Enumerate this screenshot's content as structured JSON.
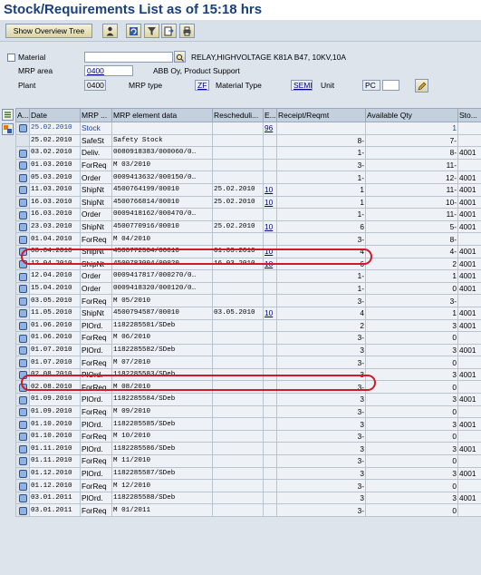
{
  "title": "Stock/Requirements List as of 15:18 hrs",
  "toolbar": {
    "overview_tree_label": "Show Overview Tree"
  },
  "header": {
    "material_label": "Material",
    "material_value": "",
    "material_desc": "RELAY,HIGHVOLTAGE K81A B47, 10KV,10A",
    "mrp_area_label": "MRP area",
    "mrp_area_value": "0400",
    "mrp_area_desc": "ABB Oy, Product Support",
    "plant_label": "Plant",
    "plant_value": "0400",
    "mrp_type_label": "MRP type",
    "mrp_type_value": "ZF",
    "material_type_label": "Material Type",
    "material_type_value": "SEMI",
    "unit_label": "Unit",
    "unit_value": "PC"
  },
  "table": {
    "columns": [
      "A...",
      "Date",
      "MRP ...",
      "MRP element data",
      "Rescheduli...",
      "E...",
      "Receipt/Reqmt",
      "Available Qty",
      "Sto..."
    ],
    "rows": [
      {
        "date": "25.02.2010",
        "elem": "Stock",
        "data": "",
        "resched": "",
        "e": "96",
        "rec": "",
        "avail": "1",
        "sto": "",
        "icon": true,
        "blue": true
      },
      {
        "date": "25.02.2010",
        "elem": "SafeSt",
        "data": "Safety Stock",
        "resched": "",
        "e": "",
        "rec": "8-",
        "avail": "7-",
        "sto": "",
        "icon": false,
        "blue": false
      },
      {
        "date": "03.02.2010",
        "elem": "Deliv.",
        "data": "0080918383/000060/0…",
        "resched": "",
        "e": "",
        "rec": "1-",
        "avail": "8-",
        "sto": "4001",
        "icon": true,
        "blue": false
      },
      {
        "date": "01.03.2010",
        "elem": "ForReq",
        "data": "M 03/2010",
        "resched": "",
        "e": "",
        "rec": "3-",
        "avail": "11-",
        "sto": "",
        "icon": true,
        "blue": false
      },
      {
        "date": "05.03.2010",
        "elem": "Order",
        "data": "0009413632/000150/0…",
        "resched": "",
        "e": "",
        "rec": "1-",
        "avail": "12-",
        "sto": "4001",
        "icon": true,
        "blue": false
      },
      {
        "date": "11.03.2010",
        "elem": "ShipNt",
        "data": "4500764199/00010",
        "resched": "25.02.2010",
        "e": "10",
        "rec": "1",
        "avail": "11-",
        "sto": "4001",
        "icon": true,
        "blue": false
      },
      {
        "date": "16.03.2010",
        "elem": "ShipNt",
        "data": "4500766814/00010",
        "resched": "25.02.2010",
        "e": "10",
        "rec": "1",
        "avail": "10-",
        "sto": "4001",
        "icon": true,
        "blue": false
      },
      {
        "date": "16.03.2010",
        "elem": "Order",
        "data": "0009418162/000470/0…",
        "resched": "",
        "e": "",
        "rec": "1-",
        "avail": "11-",
        "sto": "4001",
        "icon": true,
        "blue": false
      },
      {
        "date": "23.03.2010",
        "elem": "ShipNt",
        "data": "4500770916/00010",
        "resched": "25.02.2010",
        "e": "10",
        "rec": "6",
        "avail": "5-",
        "sto": "4001",
        "icon": true,
        "blue": false
      },
      {
        "date": "01.04.2010",
        "elem": "ForReq",
        "data": "M 04/2010",
        "resched": "",
        "e": "",
        "rec": "3-",
        "avail": "8-",
        "sto": "",
        "icon": true,
        "blue": false
      },
      {
        "date": "08.04.2010",
        "elem": "ShipNt",
        "data": "4500772504/00010",
        "resched": "01.03.2010",
        "e": "10",
        "rec": "4",
        "avail": "4-",
        "sto": "4001",
        "icon": true,
        "blue": false
      },
      {
        "date": "12.04.2010",
        "elem": "ShipNt",
        "data": "4500783004/00020",
        "resched": "16.03.2010",
        "e": "10",
        "rec": "6",
        "avail": "2",
        "sto": "4001",
        "icon": true,
        "blue": false
      },
      {
        "date": "12.04.2010",
        "elem": "Order",
        "data": "0009417817/000270/0…",
        "resched": "",
        "e": "",
        "rec": "1-",
        "avail": "1",
        "sto": "4001",
        "icon": true,
        "blue": false
      },
      {
        "date": "15.04.2010",
        "elem": "Order",
        "data": "0009418320/000120/0…",
        "resched": "",
        "e": "",
        "rec": "1-",
        "avail": "0",
        "sto": "4001",
        "icon": true,
        "blue": false
      },
      {
        "date": "03.05.2010",
        "elem": "ForReq",
        "data": "M 05/2010",
        "resched": "",
        "e": "",
        "rec": "3-",
        "avail": "3-",
        "sto": "",
        "icon": true,
        "blue": false
      },
      {
        "date": "11.05.2010",
        "elem": "ShipNt",
        "data": "4500794587/00010",
        "resched": "03.05.2010",
        "e": "10",
        "rec": "4",
        "avail": "1",
        "sto": "4001",
        "icon": true,
        "blue": false
      },
      {
        "date": "01.06.2010",
        "elem": "PlOrd.",
        "data": "1182285581/SDeb",
        "resched": "",
        "e": "",
        "rec": "2",
        "avail": "3",
        "sto": "4001",
        "icon": true,
        "blue": false
      },
      {
        "date": "01.06.2010",
        "elem": "ForReq",
        "data": "M 06/2010",
        "resched": "",
        "e": "",
        "rec": "3-",
        "avail": "0",
        "sto": "",
        "icon": true,
        "blue": false
      },
      {
        "date": "01.07.2010",
        "elem": "PlOrd.",
        "data": "1182285582/SDeb",
        "resched": "",
        "e": "",
        "rec": "3",
        "avail": "3",
        "sto": "4001",
        "icon": true,
        "blue": false
      },
      {
        "date": "01.07.2010",
        "elem": "ForReq",
        "data": "M 07/2010",
        "resched": "",
        "e": "",
        "rec": "3-",
        "avail": "0",
        "sto": "",
        "icon": true,
        "blue": false
      },
      {
        "date": "02.08.2010",
        "elem": "PlOrd.",
        "data": "1182285583/SDeb",
        "resched": "",
        "e": "",
        "rec": "3",
        "avail": "3",
        "sto": "4001",
        "icon": true,
        "blue": false
      },
      {
        "date": "02.08.2010",
        "elem": "ForReq",
        "data": "M 08/2010",
        "resched": "",
        "e": "",
        "rec": "3-",
        "avail": "0",
        "sto": "",
        "icon": true,
        "blue": false
      },
      {
        "date": "01.09.2010",
        "elem": "PlOrd.",
        "data": "1182285584/SDeb",
        "resched": "",
        "e": "",
        "rec": "3",
        "avail": "3",
        "sto": "4001",
        "icon": true,
        "blue": false
      },
      {
        "date": "01.09.2010",
        "elem": "ForReq",
        "data": "M 09/2010",
        "resched": "",
        "e": "",
        "rec": "3-",
        "avail": "0",
        "sto": "",
        "icon": true,
        "blue": false
      },
      {
        "date": "01.10.2010",
        "elem": "PlOrd.",
        "data": "1182285585/SDeb",
        "resched": "",
        "e": "",
        "rec": "3",
        "avail": "3",
        "sto": "4001",
        "icon": true,
        "blue": false
      },
      {
        "date": "01.10.2010",
        "elem": "ForReq",
        "data": "M 10/2010",
        "resched": "",
        "e": "",
        "rec": "3-",
        "avail": "0",
        "sto": "",
        "icon": true,
        "blue": false
      },
      {
        "date": "01.11.2010",
        "elem": "PlOrd.",
        "data": "1182285586/SDeb",
        "resched": "",
        "e": "",
        "rec": "3",
        "avail": "3",
        "sto": "4001",
        "icon": true,
        "blue": false
      },
      {
        "date": "01.11.2010",
        "elem": "ForReq",
        "data": "M 11/2010",
        "resched": "",
        "e": "",
        "rec": "3-",
        "avail": "0",
        "sto": "",
        "icon": true,
        "blue": false
      },
      {
        "date": "01.12.2010",
        "elem": "PlOrd.",
        "data": "1182285587/SDeb",
        "resched": "",
        "e": "",
        "rec": "3",
        "avail": "3",
        "sto": "4001",
        "icon": true,
        "blue": false
      },
      {
        "date": "01.12.2010",
        "elem": "ForReq",
        "data": "M 12/2010",
        "resched": "",
        "e": "",
        "rec": "3-",
        "avail": "0",
        "sto": "",
        "icon": true,
        "blue": false
      },
      {
        "date": "03.01.2011",
        "elem": "PlOrd.",
        "data": "1182285588/SDeb",
        "resched": "",
        "e": "",
        "rec": "3",
        "avail": "3",
        "sto": "4001",
        "icon": true,
        "blue": false
      },
      {
        "date": "03.01.2011",
        "elem": "ForReq",
        "data": "M 01/2011",
        "resched": "",
        "e": "",
        "rec": "3-",
        "avail": "0",
        "sto": "",
        "icon": true,
        "blue": false
      }
    ],
    "highlighted_rows": [
      9,
      18
    ]
  },
  "colors": {
    "title": "#1a3f7a",
    "highlight_oval": "#d0192a",
    "link": "#00008b"
  }
}
